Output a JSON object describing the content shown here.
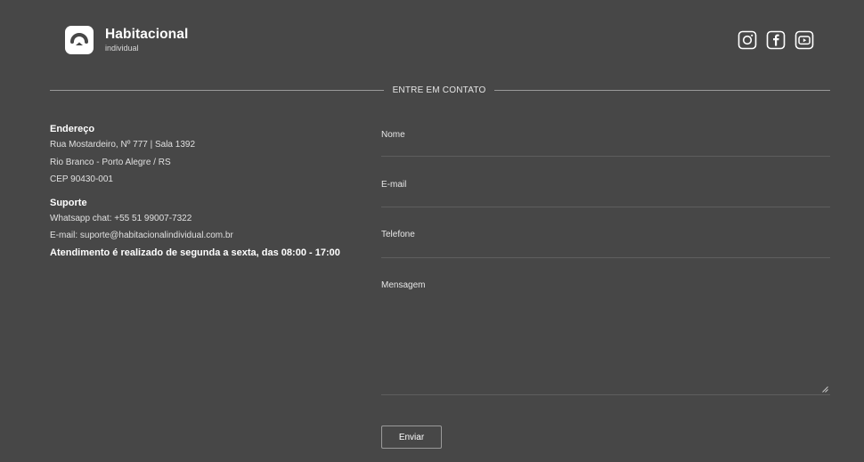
{
  "brand": {
    "name": "Habitacional",
    "tagline": "individual",
    "icon": "house-roof-icon"
  },
  "social": [
    {
      "name": "instagram",
      "icon": "instagram-icon"
    },
    {
      "name": "facebook",
      "icon": "facebook-icon"
    },
    {
      "name": "youtube",
      "icon": "youtube-icon"
    }
  ],
  "section_title": "ENTRE EM CONTATO",
  "address": {
    "heading": "Endereço",
    "line1": "Rua Mostardeiro, Nº 777 | Sala 1392",
    "line2": "Rio Branco - Porto Alegre / RS",
    "line3": "CEP 90430-001"
  },
  "support": {
    "heading": "Suporte",
    "whatsapp": "Whatsapp chat: +55 51 99007-7322",
    "email": "E-mail: suporte@habitacionalindividual.com.br",
    "hours": "Atendimento é realizado de segunda a sexta, das 08:00 - 17:00"
  },
  "form": {
    "name_label": "Nome",
    "email_label": "E-mail",
    "phone_label": "Telefone",
    "message_label": "Mensagem",
    "submit_label": "Enviar"
  },
  "colors": {
    "background": "#474747",
    "text": "#f2f2f2",
    "divider": "#9a9a9a"
  }
}
